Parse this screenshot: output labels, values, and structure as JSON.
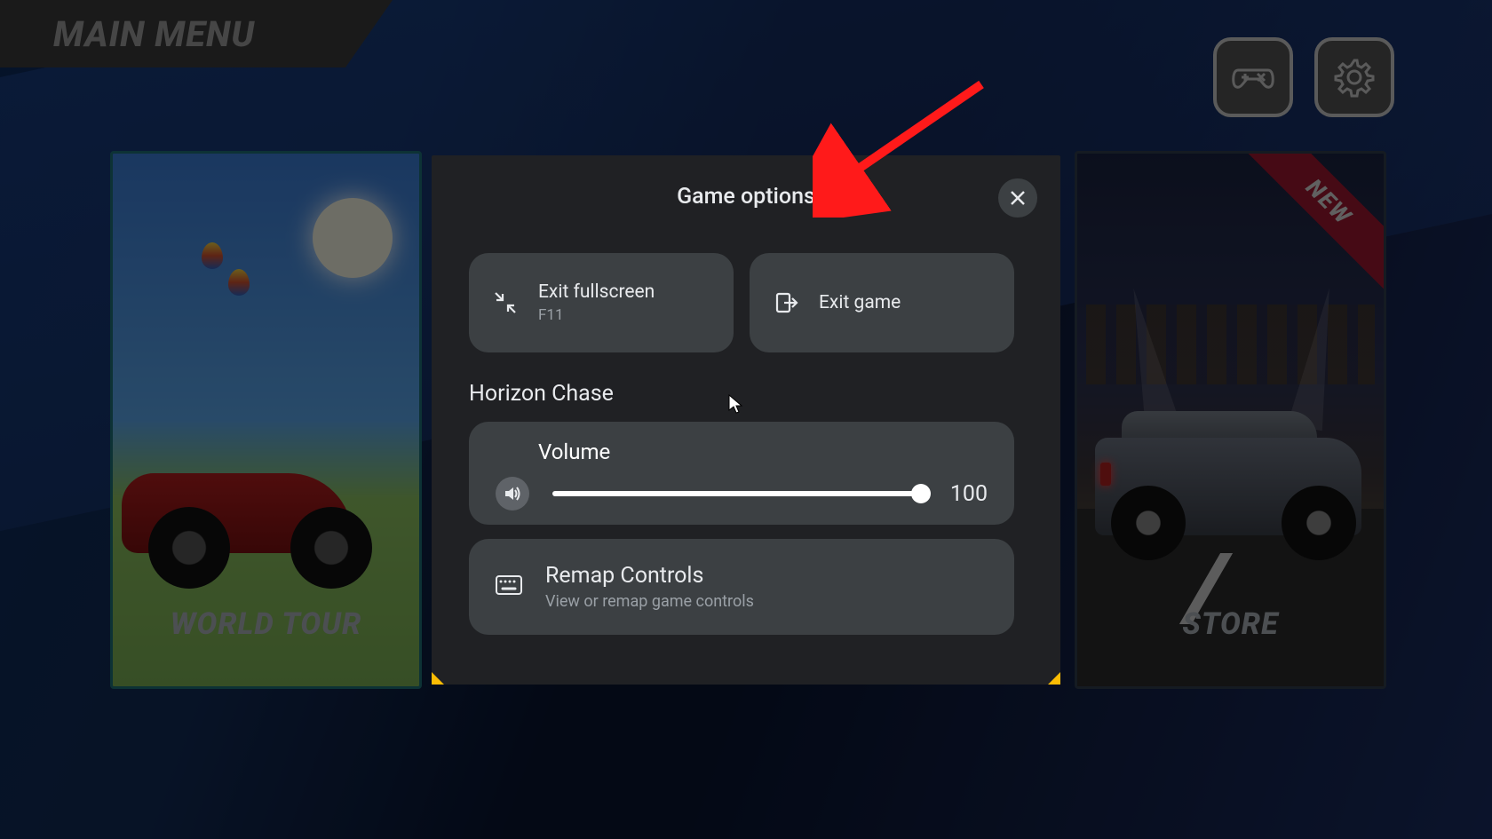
{
  "header": {
    "main_menu": "MAIN MENU"
  },
  "cards": {
    "left_label": "WORLD TOUR",
    "right_label": "STORE",
    "ribbon": "NEW"
  },
  "modal": {
    "title": "Game options",
    "exit_fullscreen": {
      "title": "Exit fullscreen",
      "sub": "F11"
    },
    "exit_game": {
      "title": "Exit game"
    },
    "section": "Horizon Chase",
    "volume": {
      "label": "Volume",
      "value": "100"
    },
    "remap": {
      "title": "Remap Controls",
      "sub": "View or remap game controls"
    }
  }
}
